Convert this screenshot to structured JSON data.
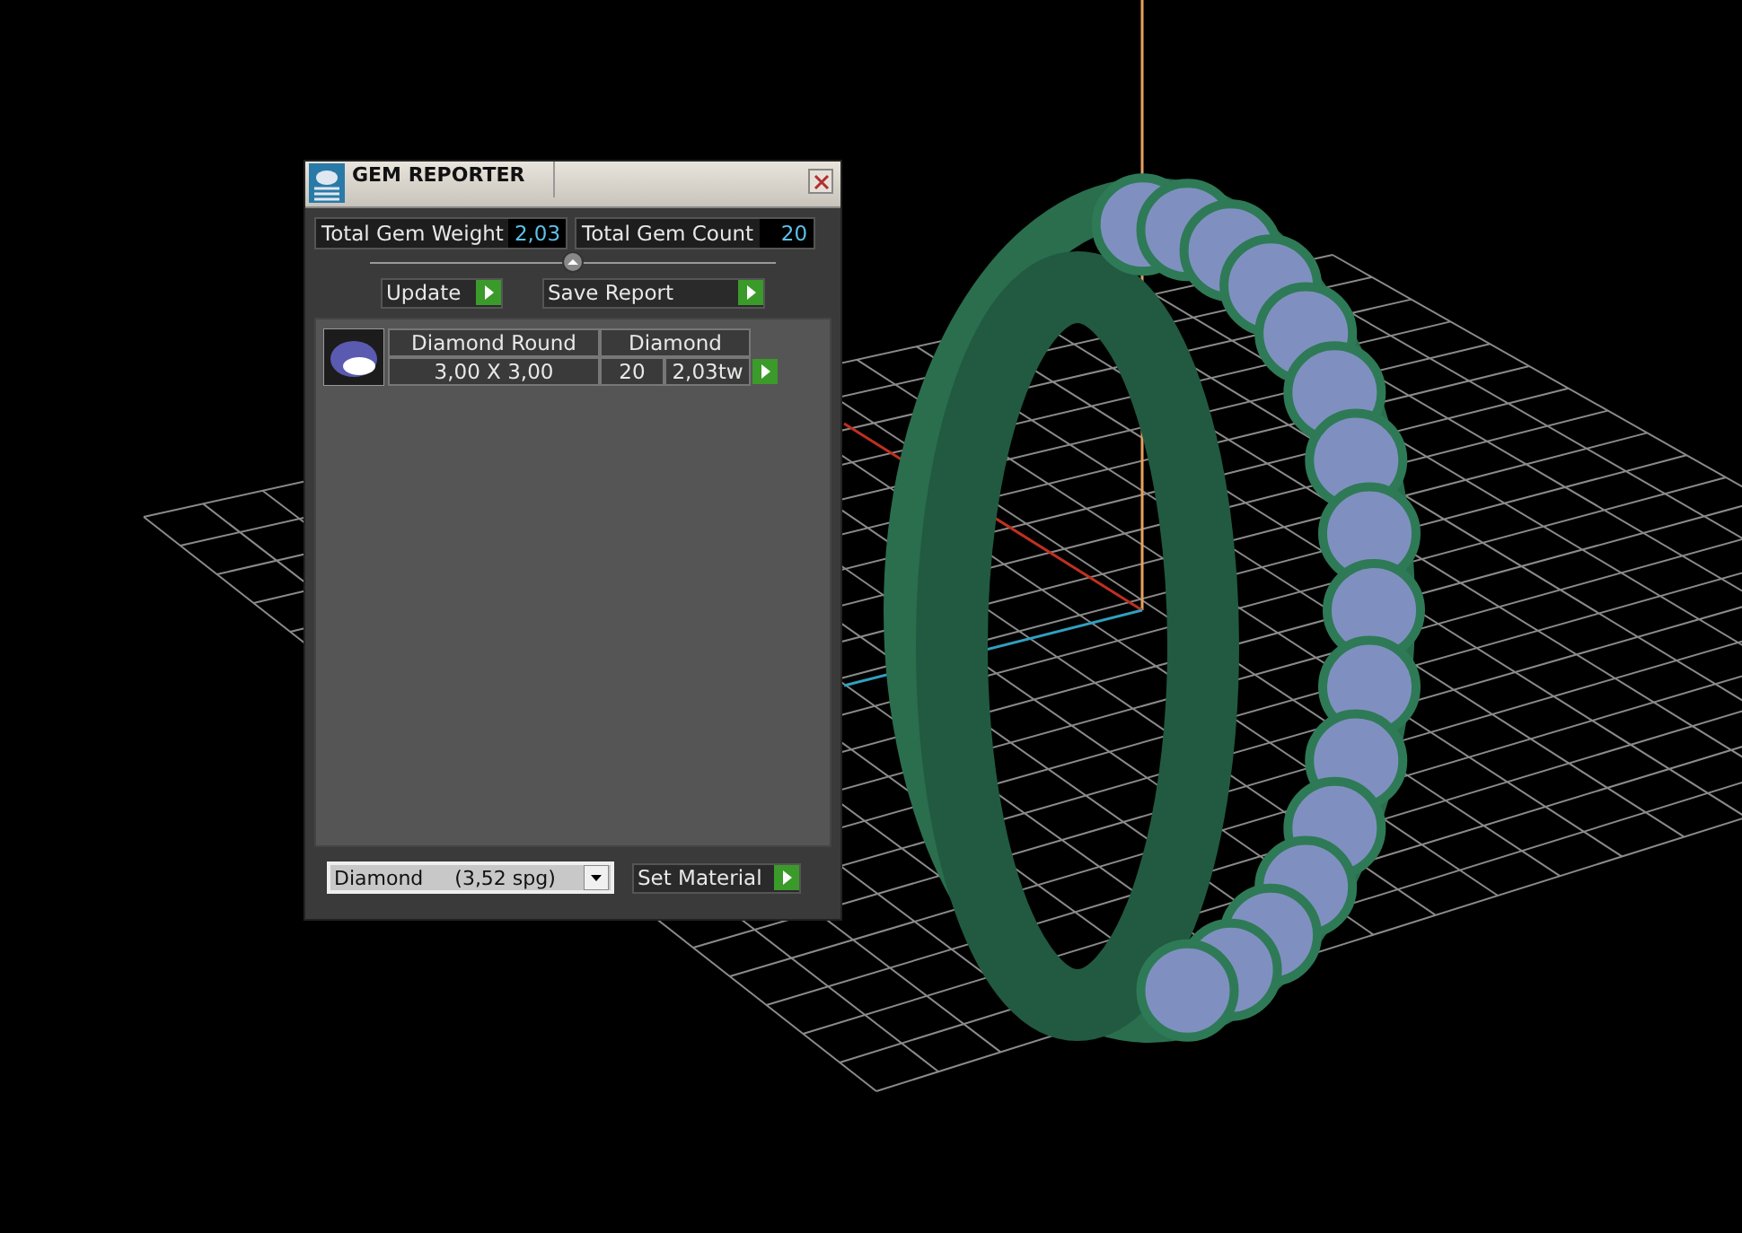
{
  "window": {
    "title": "GEM REPORTER"
  },
  "summary": [
    {
      "label": "Total Gem Weight",
      "value": "2,03"
    },
    {
      "label": "Total Gem Count",
      "value": "20"
    }
  ],
  "buttons": [
    "Update",
    "Save Report"
  ],
  "gems": [
    {
      "name": "Diamond Round",
      "material": "Diamond",
      "size": "3,00 X 3,00",
      "count": "20",
      "weight": "2,03tw"
    }
  ],
  "material_select": {
    "value": "Diamond     (3,52 spg)"
  },
  "set_button": "Set Material"
}
